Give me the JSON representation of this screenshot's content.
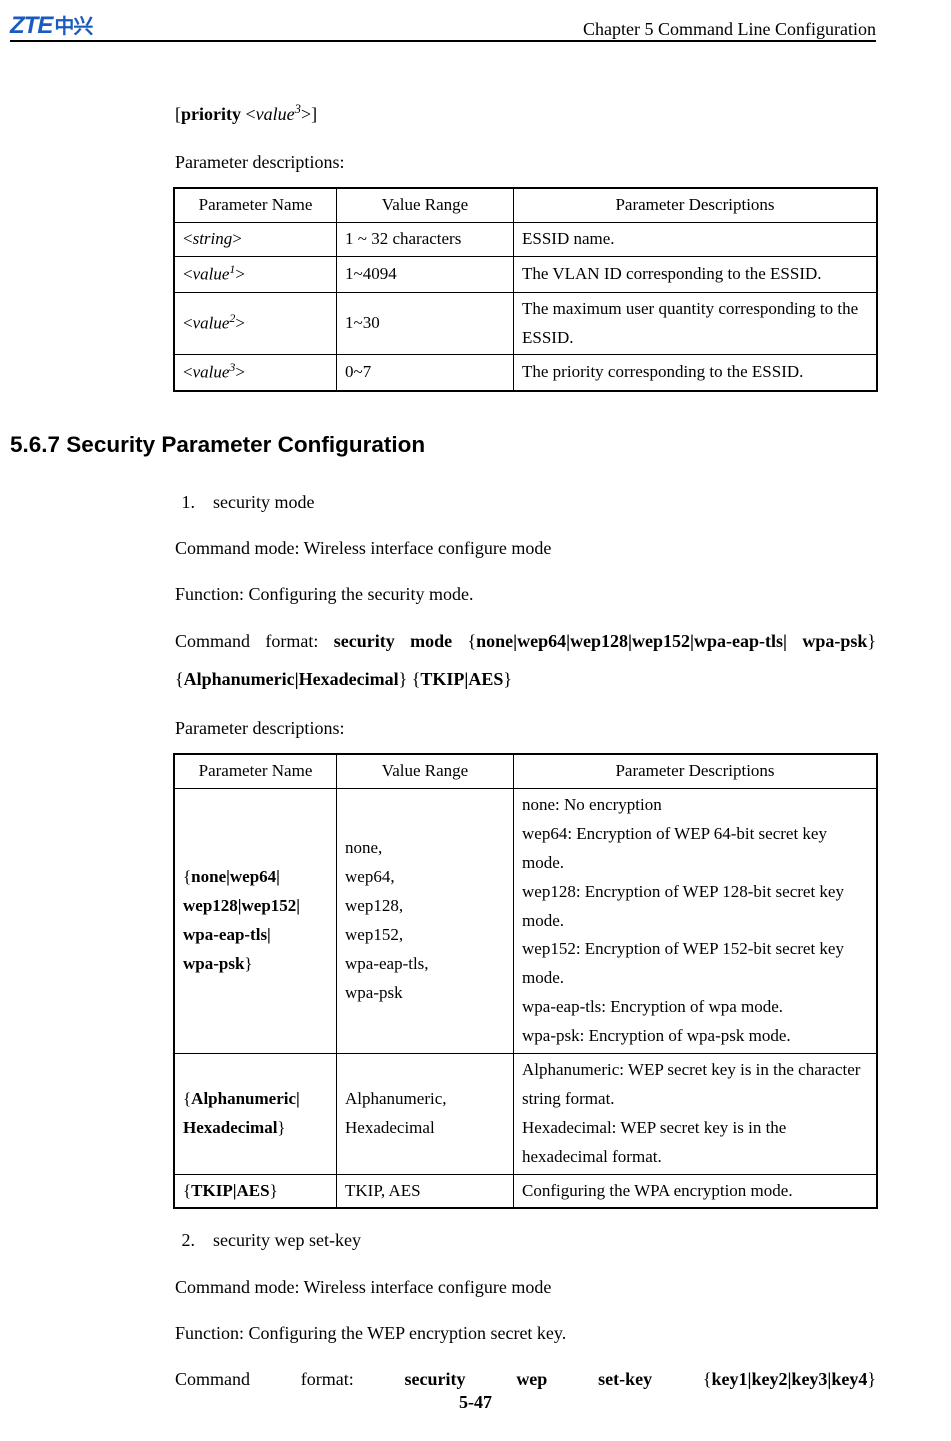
{
  "header": {
    "logo_main": "ZTE",
    "logo_cn": "中兴",
    "chapter": "Chapter 5 Command Line Configuration"
  },
  "intro": {
    "priority_open": "[",
    "priority_kw": "priority",
    "priority_lt": " <",
    "priority_val": "value",
    "priority_sup": "3",
    "priority_close": ">]",
    "param_desc_label": "Parameter descriptions:"
  },
  "table1": {
    "h1": "Parameter Name",
    "h2": "Value Range",
    "h3": "Parameter Descriptions",
    "rows": [
      {
        "name_open": "<",
        "name_val": "string",
        "name_close": ">",
        "range": "1 ~ 32 characters",
        "desc": "ESSID name."
      },
      {
        "name_open": "<",
        "name_val": "value",
        "name_sup": "1",
        "name_close": ">",
        "range": "1~4094",
        "desc": "The VLAN ID corresponding to the ESSID."
      },
      {
        "name_open": "<",
        "name_val": "value",
        "name_sup": "2",
        "name_close": ">",
        "range": "1~30",
        "desc": "The maximum user quantity corresponding to the ESSID."
      },
      {
        "name_open": "<",
        "name_val": "value",
        "name_sup": "3",
        "name_close": ">",
        "range": "0~7",
        "desc": "The priority corresponding to the ESSID."
      }
    ]
  },
  "section": {
    "heading": "5.6.7 Security Parameter Configuration",
    "item1_num": "1.",
    "item1_title": "security mode",
    "cmd_mode": "Command mode: Wireless interface configure mode",
    "func1": "Function: Configuring the security mode.",
    "cmd_fmt_prefix": "Command format:  ",
    "cmd_fmt_b1": "security  mode",
    "cmd_fmt_sp1": "  {",
    "cmd_fmt_b2": "none|wep64|wep128|wep152|wpa-eap-tls|",
    "cmd_fmt_b3": "wpa-psk",
    "cmd_fmt_sp2": "} {",
    "cmd_fmt_b4": "Alphanumeric|Hexadecimal",
    "cmd_fmt_sp3": "} {",
    "cmd_fmt_b5": "TKIP|AES",
    "cmd_fmt_sp4": "}",
    "param_desc_label2": "Parameter descriptions:"
  },
  "table2": {
    "h1": "Parameter Name",
    "h2": "Value Range",
    "h3": "Parameter Descriptions",
    "r1_name_open": "{",
    "r1_name_b1": "none|wep64|",
    "r1_name_b2": "wep128|wep152|",
    "r1_name_b3": "wpa-eap-tls|",
    "r1_name_b4": "wpa-psk",
    "r1_name_close": "}",
    "r1_range": "none,\nwep64,\nwep128,\nwep152,\nwpa-eap-tls,\nwpa-psk",
    "r1_desc": "none: No encryption\nwep64: Encryption of WEP 64-bit secret key mode.\nwep128: Encryption of WEP 128-bit secret key mode.\nwep152: Encryption of WEP 152-bit secret key mode.\nwpa-eap-tls: Encryption of wpa mode.\nwpa-psk: Encryption of wpa-psk mode.",
    "r2_name_open": "{",
    "r2_name_b1": "Alphanumeric|",
    "r2_name_b2": "Hexadecimal",
    "r2_name_close": "}",
    "r2_range": "Alphanumeric,\nHexadecimal",
    "r2_desc": "Alphanumeric: WEP secret key is in the character string format.\nHexadecimal: WEP secret key is in the hexadecimal format.",
    "r3_name_open": "{",
    "r3_name_b1": "TKIP|AES",
    "r3_name_close": "}",
    "r3_range": "TKIP, AES",
    "r3_desc": "Configuring the WPA encryption mode."
  },
  "item2": {
    "num": "2.",
    "title": "security wep set-key",
    "cmd_mode": "Command mode: Wireless interface configure mode",
    "func": "Function: Configuring the WEP encryption secret key.",
    "cmd_prefix": "Command",
    "cmd_word2": "format:",
    "cmd_b1": "security",
    "cmd_b2": "wep",
    "cmd_b3": "set-key",
    "cmd_sp1": "{",
    "cmd_b4": "key1|key2|key3|key4",
    "cmd_sp2": "}"
  },
  "footer": {
    "page_num": "5-47"
  }
}
